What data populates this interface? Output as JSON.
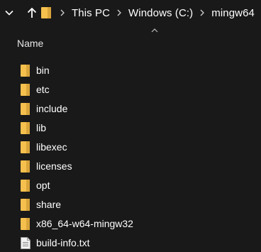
{
  "address_bar": {
    "crumbs": [
      "This PC",
      "Windows (C:)",
      "mingw64"
    ]
  },
  "header": {
    "name_column": "Name"
  },
  "items": [
    {
      "name": "bin",
      "type": "folder"
    },
    {
      "name": "etc",
      "type": "folder"
    },
    {
      "name": "include",
      "type": "folder"
    },
    {
      "name": "lib",
      "type": "folder"
    },
    {
      "name": "libexec",
      "type": "folder"
    },
    {
      "name": "licenses",
      "type": "folder"
    },
    {
      "name": "opt",
      "type": "folder"
    },
    {
      "name": "share",
      "type": "folder"
    },
    {
      "name": "x86_64-w64-mingw32",
      "type": "folder"
    },
    {
      "name": "build-info.txt",
      "type": "file"
    }
  ],
  "colors": {
    "background": "#191919",
    "folder": "#f5c04e",
    "text": "#ffffff"
  }
}
